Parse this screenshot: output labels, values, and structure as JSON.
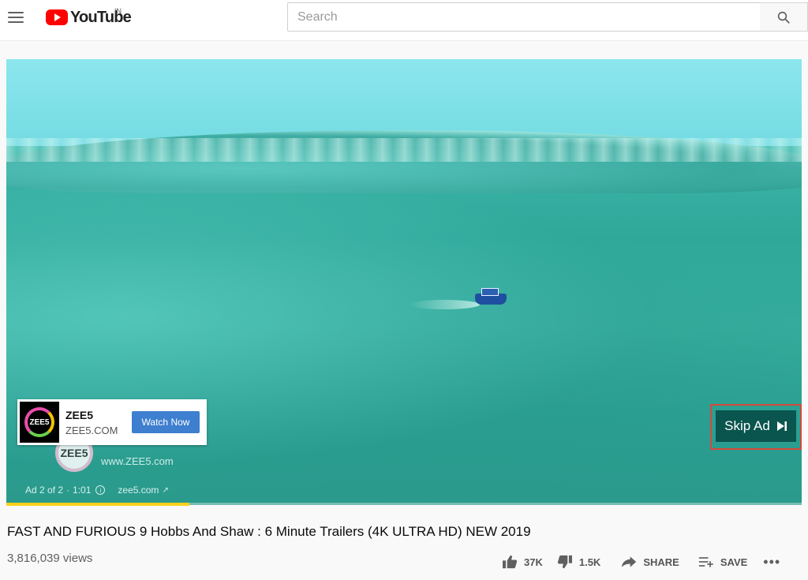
{
  "header": {
    "logo_text": "YouTube",
    "region": "IN",
    "search_placeholder": "Search"
  },
  "player": {
    "ad_card": {
      "advertiser": "ZEE5",
      "domain": "ZEE5.COM",
      "cta_label": "Watch Now",
      "logo_text": "ZEE5"
    },
    "watermark": {
      "logo_text": "ZEE5",
      "url": "www.ZEE5.com"
    },
    "ad_status": {
      "ad_position": "Ad 2 of 2",
      "separator": "·",
      "time": "1:01",
      "link": "zee5.com"
    },
    "skip_label": "Skip Ad",
    "progress_fraction": 0.23,
    "progress_color": "#fcd11c"
  },
  "video": {
    "title": "FAST AND FURIOUS 9 Hobbs And Shaw : 6 Minute Trailers (4K ULTRA HD) NEW 2019",
    "views": "3,816,039 views",
    "likes": "37K",
    "dislikes": "1.5K",
    "share_label": "SHARE",
    "save_label": "SAVE",
    "more_label": "•••"
  },
  "icons": {
    "menu": "menu-icon",
    "search": "search-icon",
    "like": "thumbs-up-icon",
    "dislike": "thumbs-down-icon",
    "share": "share-arrow-icon",
    "save": "playlist-add-icon",
    "skip": "skip-next-icon",
    "info": "info-icon",
    "external": "external-link-icon"
  },
  "colors": {
    "brand_red": "#ff0000",
    "cta_blue": "#3e7fcf",
    "highlight_outline": "#d7483a"
  }
}
